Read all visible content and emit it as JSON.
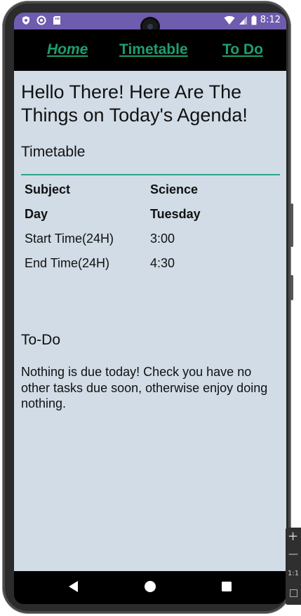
{
  "status_bar": {
    "time": "8:12"
  },
  "nav": {
    "home_label": "Home",
    "timetable_label": "Timetable",
    "todo_label": "To Do"
  },
  "main": {
    "heading": "Hello There! Here Are The Things on Today's Agenda!",
    "timetable_title": "Timetable",
    "timetable_rows": [
      {
        "label": "Subject",
        "value": "Science"
      },
      {
        "label": "Day",
        "value": "Tuesday"
      },
      {
        "label": "Start Time(24H)",
        "value": "3:00"
      },
      {
        "label": "End Time(24H)",
        "value": "4:30"
      }
    ],
    "todo_title": "To-Do",
    "todo_text": "Nothing is due today! Check you have no other tasks due soon, otherwise enjoy doing nothing."
  },
  "emulator_panel": {
    "ratio_label": "1:1"
  },
  "colors": {
    "status_bar": "#6e5cae",
    "nav_link": "#1e9e6e",
    "content_bg": "#d1dce6",
    "divider": "#2aa58a"
  }
}
